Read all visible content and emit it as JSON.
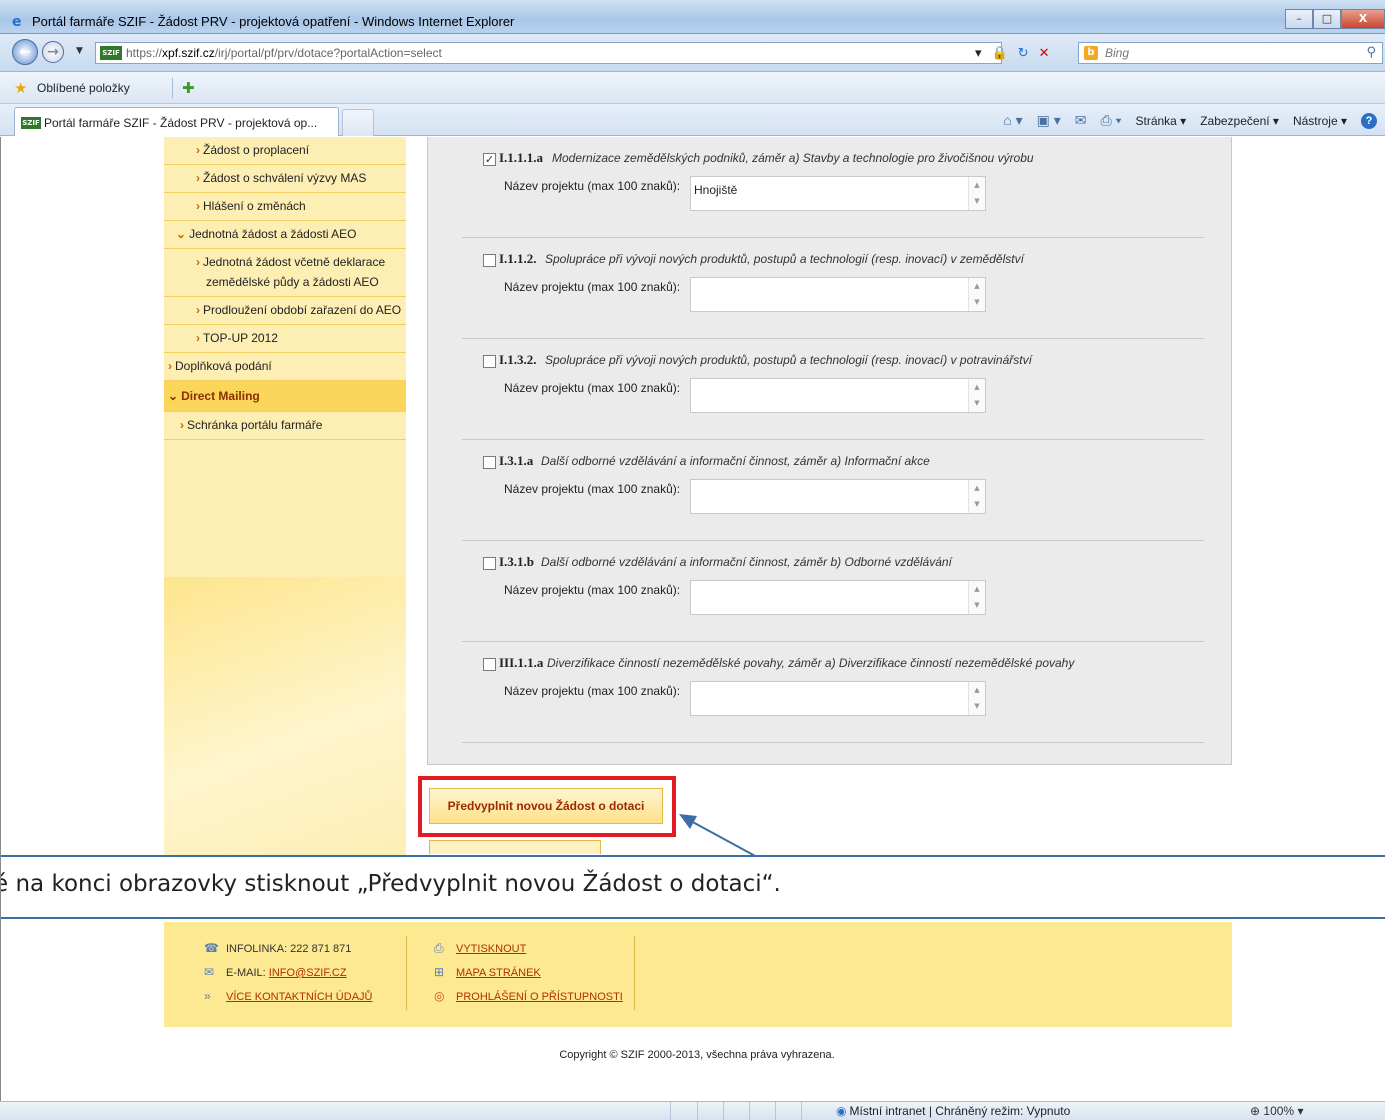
{
  "window": {
    "title": "Portál farmáře SZIF - Žádost PRV - projektová opatření - Windows Internet Explorer",
    "minimize": "–",
    "maximize": "□",
    "close": "X"
  },
  "address": {
    "url_prefix": "https://",
    "url_domain": "xpf.szif.cz",
    "url_path": "/irj/portal/pf/prv/dotace?portalAction=select",
    "site_badge": "SZIF",
    "search_placeholder": "Bing"
  },
  "favorites": {
    "label": "Oblíbené položky"
  },
  "tab": {
    "title": "Portál farmáře SZIF - Žádost PRV - projektová op..."
  },
  "commands": {
    "page": "Stránka ▾",
    "safety": "Zabezpečení ▾",
    "tools": "Nástroje ▾"
  },
  "sidebar": {
    "items": [
      {
        "label": "Žádost o proplacení"
      },
      {
        "label": "Žádost o schválení výzvy MAS"
      },
      {
        "label": "Hlášení o změnách"
      },
      {
        "label": "Jednotná žádost a žádosti AEO"
      },
      {
        "label_line1": "Jednotná žádost včetně deklarace",
        "label_line2": "zemědělské půdy a žádosti AEO"
      },
      {
        "label": "Prodloužení období zařazení do AEO"
      },
      {
        "label": "TOP-UP 2012"
      },
      {
        "label": "Doplňková podání"
      },
      {
        "label": "Direct Mailing"
      },
      {
        "label": "Schránka portálu farmáře"
      }
    ]
  },
  "options": [
    {
      "code": "I.1.1.1.a",
      "desc": "Modernizace zemědělských podniků, záměr a) Stavby a technologie pro živočišnou výrobu",
      "checked": true,
      "field_label": "Název projektu (max 100 znaků):",
      "value": "Hnojiště"
    },
    {
      "code": "I.1.1.2.",
      "desc": "Spolupráce při vývoji nových produktů, postupů a technologií (resp. inovací) v zemědělství",
      "checked": false,
      "field_label": "Název projektu (max 100 znaků):",
      "value": ""
    },
    {
      "code": "I.1.3.2.",
      "desc": "Spolupráce při vývoji nových produktů, postupů a technologií (resp. inovací) v potravinářství",
      "checked": false,
      "field_label": "Název projektu (max 100 znaků):",
      "value": ""
    },
    {
      "code": "I.3.1.a",
      "desc": "Další odborné vzdělávání a informační činnost, záměr a) Informační akce",
      "checked": false,
      "field_label": "Název projektu (max 100 znaků):",
      "value": ""
    },
    {
      "code": "I.3.1.b",
      "desc": "Další odborné vzdělávání a informační činnost, záměr b) Odborné vzdělávání",
      "checked": false,
      "field_label": "Název projektu (max 100 znaků):",
      "value": ""
    },
    {
      "code": "III.1.1.a",
      "desc": "Diverzifikace činností nezemědělské povahy, záměr a) Diverzifikace činností nezemědělské povahy",
      "checked": false,
      "field_label": "Název projektu (max 100 znaků):",
      "value": ""
    }
  ],
  "prefill_button": "Předvyplnit novou Žádost o dotaci",
  "caption": "é na konci obrazovky stisknout „Předvyplnit novou Žádost o dotaci“.",
  "footer": {
    "infoline": "INFOLINKA: 222 871 871",
    "email_label": "E-MAIL:",
    "email": "INFO@SZIF.CZ",
    "contacts": "VÍCE KONTAKTNÍCH ÚDAJŮ",
    "print": "VYTISKNOUT",
    "sitemap": "MAPA STRÁNEK",
    "accessibility": "PROHLÁŠENÍ O PŘÍSTUPNOSTI",
    "copyright": "Copyright © SZIF 2000-2013, všechna práva vyhrazena."
  },
  "status": {
    "zone": "Místní intranet | Chráněný režim: Vypnuto",
    "zoom": "100%"
  },
  "colors": {
    "sidebar_bg": "#fdeeb4",
    "sidebar_active": "#fbd65a",
    "highlight_red": "#e11b22",
    "annotation_blue": "#3b6ea5",
    "footer_bg": "#fde992"
  }
}
